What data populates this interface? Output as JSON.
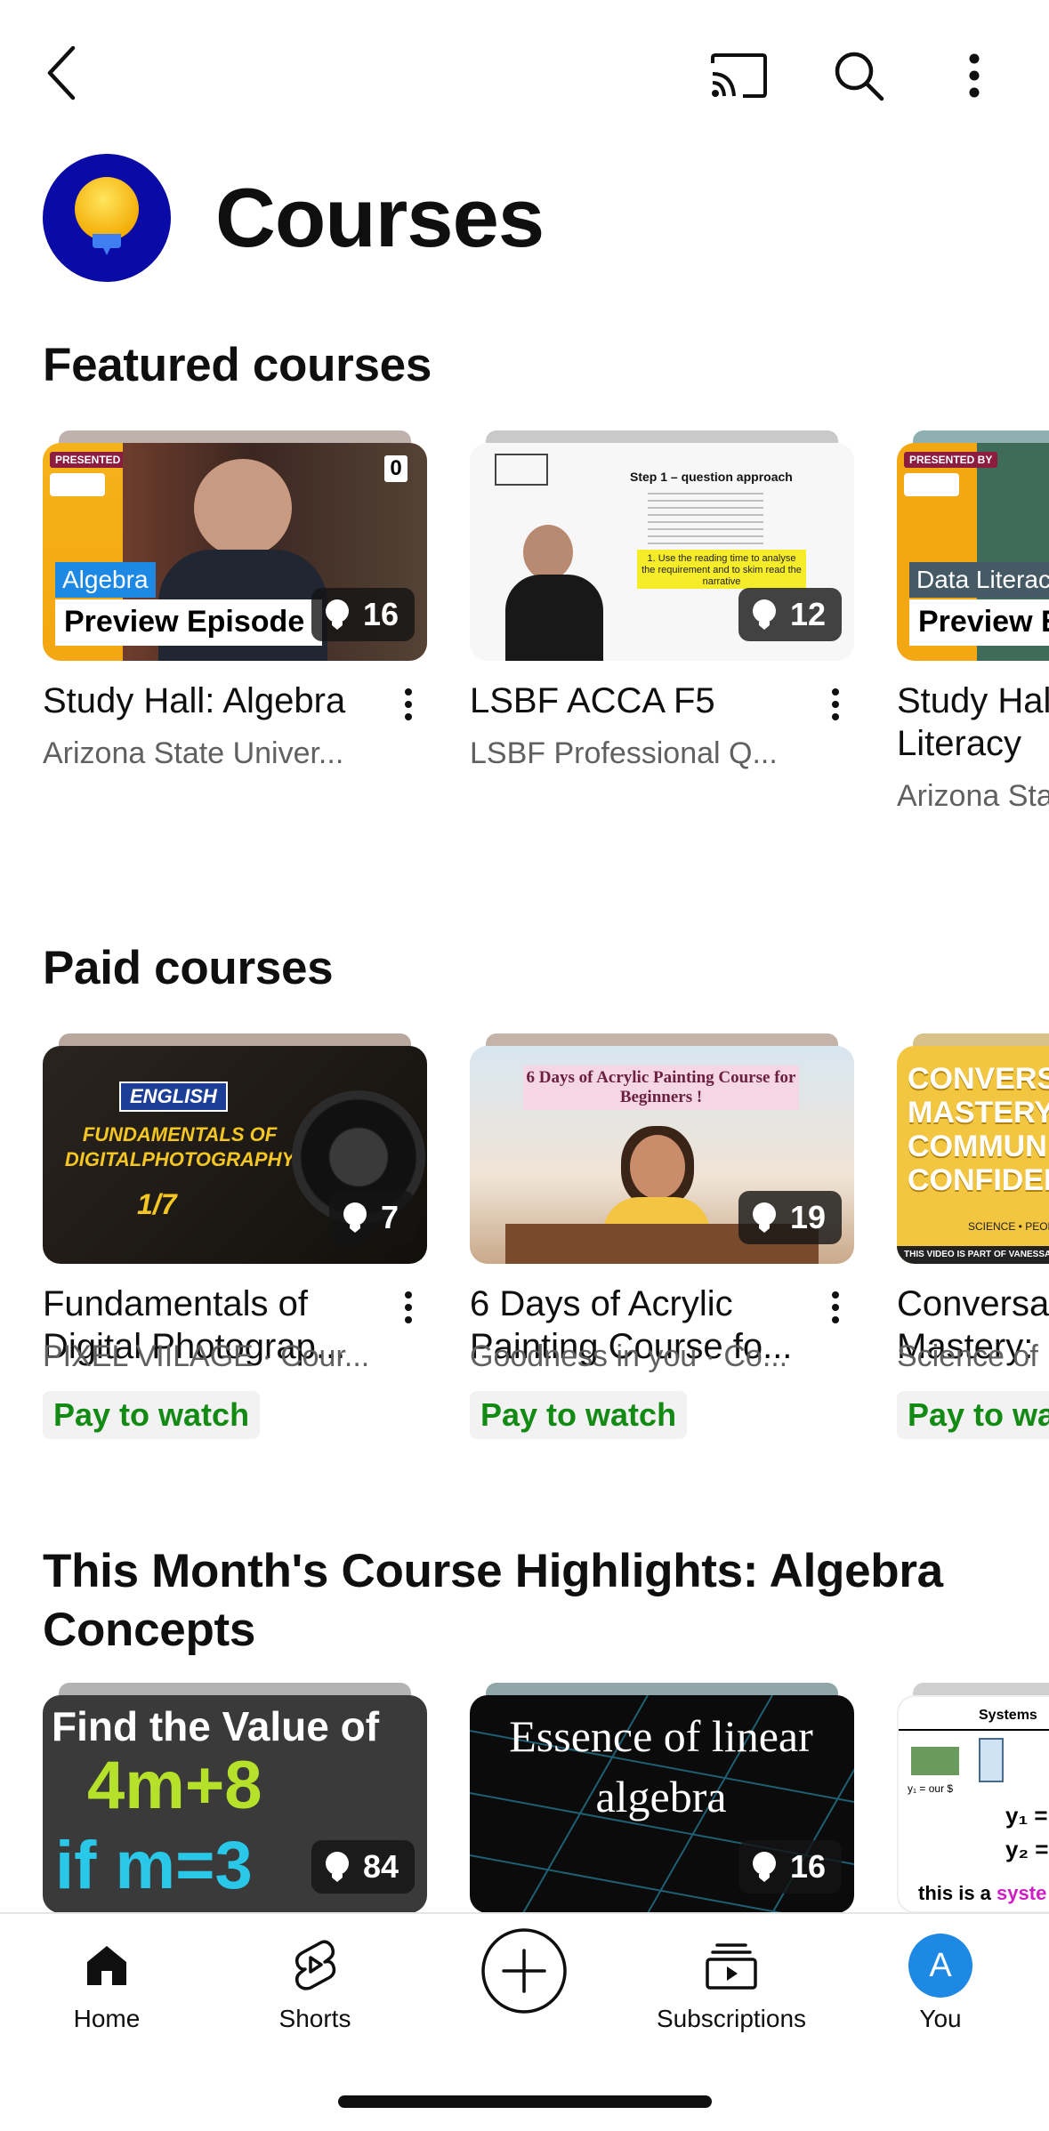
{
  "header": {
    "title": "Courses"
  },
  "sections": {
    "featured": {
      "title": "Featured courses",
      "cards": [
        {
          "title": "Study Hall: Algebra",
          "meta": "Arizona State Univer...",
          "count": "16",
          "thumb_tag": "Algebra",
          "thumb_banner": "Preview Episode",
          "thumb_badge": "0",
          "thumb_presented": "PRESENTED BY"
        },
        {
          "title": "LSBF ACCA F5",
          "meta": "LSBF Professional Q...",
          "count": "12",
          "thumb_heading": "Step 1 – question approach",
          "thumb_note": "1. Use the reading time to analyse the requirement and to skim read the narrative"
        },
        {
          "title": "Study Hall: Data Literacy",
          "meta": "Arizona State Univer...",
          "thumb_tag": "Data Literacy",
          "thumb_banner": "Preview Episode",
          "thumb_presented": "PRESENTED BY"
        }
      ]
    },
    "paid": {
      "title": "Paid courses",
      "cards": [
        {
          "title": "Fundamentals of Digital Photograp...",
          "meta": "PIXEL VIILAGE · Cour...",
          "count": "7",
          "badge": "Pay to watch",
          "thumb_lang": "ENGLISH",
          "thumb_text": "FUNDAMENTALS OF DIGITALPHOTOGRAPHY",
          "thumb_part": "1/7"
        },
        {
          "title": "6 Days of Acrylic Painting Course fo...",
          "meta": "Goodness in you · Co...",
          "count": "19",
          "badge": "Pay to watch",
          "thumb_banner": "6 Days of Acrylic Painting Course for Beginners !"
        },
        {
          "title": "Conversation Mastery:",
          "meta": "Science of People",
          "badge": "Pay to watch",
          "thumb_text": "CONVERSATION MASTERY: COMMUNICATE WITH CONFIDENCE",
          "thumb_sub": "SCIENCE • PEOPLE",
          "thumb_foot": "THIS VIDEO IS PART OF VANESSA"
        }
      ]
    },
    "highlights": {
      "title": "This Month's Course Highlights: Algebra Concepts",
      "cards": [
        {
          "count": "84",
          "thumb_line1": "Find the Value of",
          "thumb_line2": "4m+8",
          "thumb_line3": "if m=3"
        },
        {
          "count": "16",
          "thumb_text": "Essence of linear algebra"
        },
        {
          "thumb_heading": "Systems",
          "thumb_caption": "y₁ = our $",
          "thumb_eq1": "y₁ =",
          "thumb_eq2": "y₂ =",
          "thumb_foot": "this is a",
          "thumb_foot_accent": "syste"
        }
      ]
    }
  },
  "bottom_nav": {
    "items": [
      {
        "label": "Home",
        "icon": "home-icon"
      },
      {
        "label": "Shorts",
        "icon": "shorts-icon"
      },
      {
        "label": "",
        "icon": "create-icon"
      },
      {
        "label": "Subscriptions",
        "icon": "subscriptions-icon"
      },
      {
        "label": "You",
        "icon": "avatar",
        "avatar_letter": "A"
      }
    ]
  },
  "colors": {
    "accent_red": "#ff0000",
    "pay_green": "#138a13",
    "logo_bg": "#0a0aa6",
    "avatar_bg": "#1e88e5"
  }
}
